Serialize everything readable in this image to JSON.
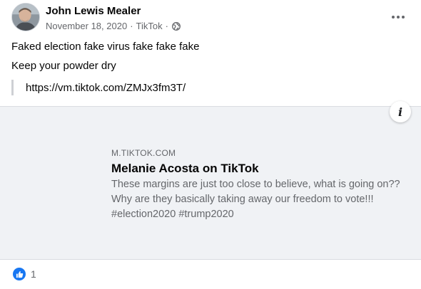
{
  "post": {
    "author": "John Lewis Mealer",
    "date": "November 18, 2020",
    "separator": "·",
    "source": "TikTok",
    "privacy_icon": "globe-icon",
    "more_icon": "more-options-icon",
    "lines": [
      "Faked election fake virus fake fake fake",
      "Keep your powder dry"
    ],
    "shared_url": "https://vm.tiktok.com/ZMJx3fm3T/"
  },
  "link_preview": {
    "info_label": "i",
    "domain": "M.TIKTOK.COM",
    "title": "Melanie Acosta on TikTok",
    "description": "These margins are just too close to believe, what is going on?? Why are they basically taking away our freedom to vote!!! #election2020 #trump2020",
    "background_color": "#f0f2f5"
  },
  "reactions": {
    "icon": "like-icon",
    "count": "1",
    "color": "#1877f2"
  }
}
